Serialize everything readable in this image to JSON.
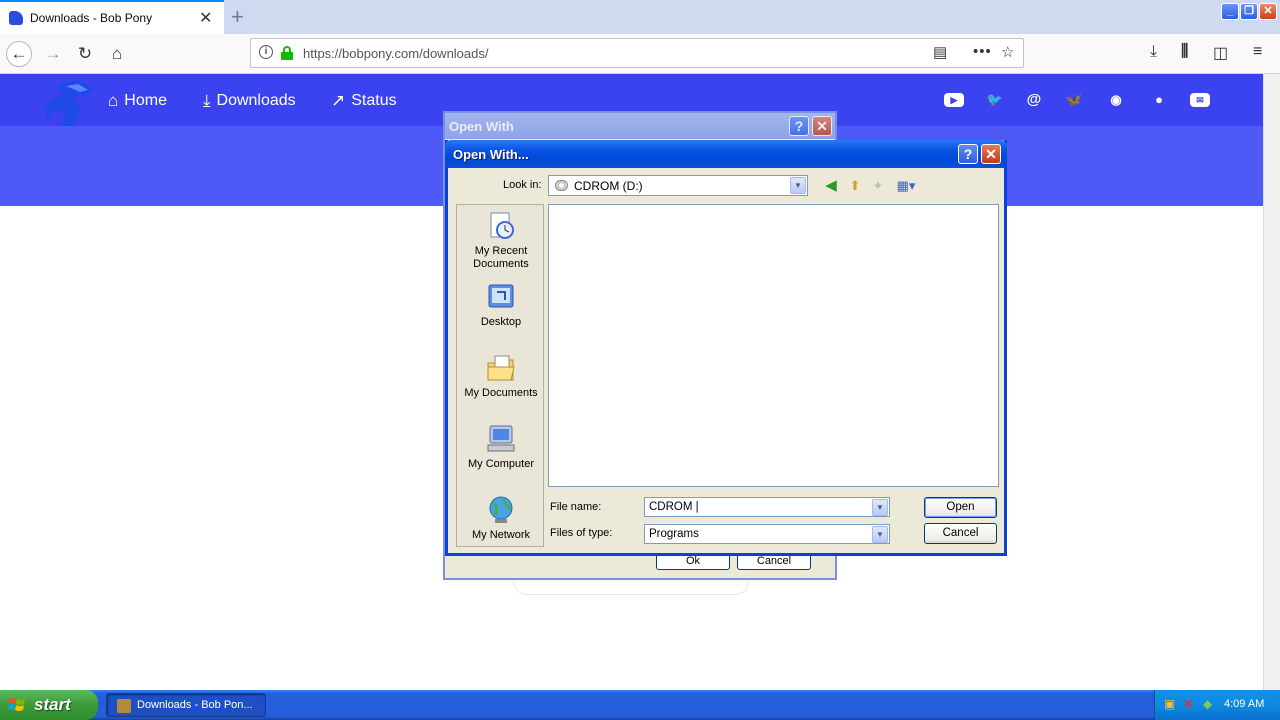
{
  "browser": {
    "tab_title": "Downloads - Bob Pony",
    "url": "https://bobpony.com/downloads/"
  },
  "site": {
    "nav": [
      {
        "label": "Home",
        "icon": "home-icon"
      },
      {
        "label": "Downloads",
        "icon": "download-icon"
      },
      {
        "label": "Status",
        "icon": "trend-icon"
      }
    ],
    "social_icons": [
      "youtube-icon",
      "twitter-icon",
      "mastodon-icon",
      "bluesky-icon",
      "discord-icon",
      "github-icon",
      "email-icon"
    ],
    "header_color": "#3b42f0"
  },
  "background_dialog": {
    "title": "Open With",
    "ok_label": "Ok",
    "cancel_label": "Cancel"
  },
  "dialog": {
    "title": "Open With...",
    "look_in_label": "Look in:",
    "look_in_value": "CDROM (D:)",
    "places": [
      {
        "label": "My Recent Documents",
        "icon": "recent-documents-icon"
      },
      {
        "label": "Desktop",
        "icon": "desktop-icon"
      },
      {
        "label": "My Documents",
        "icon": "my-documents-icon"
      },
      {
        "label": "My Computer",
        "icon": "my-computer-icon"
      },
      {
        "label": "My Network",
        "icon": "my-network-icon"
      }
    ],
    "file_name_label": "File name:",
    "file_name_value": "CDROM |",
    "files_of_type_label": "Files of type:",
    "files_of_type_value": "Programs",
    "open_label": "Open",
    "cancel_label": "Cancel"
  },
  "taskbar": {
    "start_label": "start",
    "task_label": "Downloads - Bob Pon...",
    "clock": "4:09 AM"
  }
}
